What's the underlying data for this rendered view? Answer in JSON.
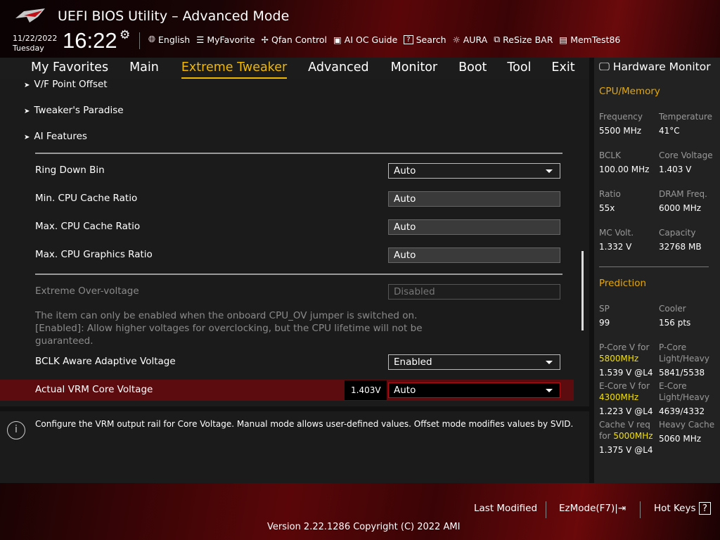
{
  "header": {
    "title": "UEFI BIOS Utility – Advanced Mode",
    "date": "11/22/2022",
    "day": "Tuesday",
    "time": "16:22",
    "tools": [
      {
        "icon": "globe-icon",
        "label": "English"
      },
      {
        "icon": "list-icon",
        "label": "MyFavorite"
      },
      {
        "icon": "fan-icon",
        "label": "Qfan Control"
      },
      {
        "icon": "ai-chip-icon",
        "label": "AI OC Guide"
      },
      {
        "icon": "search-icon",
        "label": "Search"
      },
      {
        "icon": "aura-icon",
        "label": "AURA"
      },
      {
        "icon": "resize-bar-icon",
        "label": "ReSize BAR"
      },
      {
        "icon": "memory-icon",
        "label": "MemTest86"
      }
    ]
  },
  "nav": [
    "My Favorites",
    "Main",
    "Extreme Tweaker",
    "Advanced",
    "Monitor",
    "Boot",
    "Tool",
    "Exit"
  ],
  "main": {
    "submenus": [
      "V/F Point Offset",
      "Tweaker's Paradise",
      "AI Features"
    ],
    "settings": [
      {
        "label": "Ring Down Bin",
        "value": "Auto"
      },
      {
        "label": "Min. CPU Cache Ratio",
        "value": "Auto"
      },
      {
        "label": "Max. CPU Cache Ratio",
        "value": "Auto"
      },
      {
        "label": "Max. CPU Graphics Ratio",
        "value": "Auto"
      }
    ],
    "ov": {
      "label": "Extreme Over-voltage",
      "value": "Disabled",
      "desc1": "The item can only be enabled when the onboard CPU_OV jumper is switched on.",
      "desc2": "[Enabled]: Allow higher voltages for overclocking, but the CPU lifetime will not be",
      "desc3": "guaranteed."
    },
    "bclk": {
      "label": "BCLK Aware Adaptive Voltage",
      "value": "Enabled"
    },
    "vrm": {
      "label": "Actual VRM Core Voltage",
      "reading": "1.403V",
      "value": "Auto"
    }
  },
  "help": "Configure the VRM output rail for Core Voltage. Manual mode allows user-defined values. Offset mode modifies values by SVID.",
  "hw": {
    "title": "Hardware Monitor",
    "cpu_title": "CPU/Memory",
    "cpu": [
      [
        "Frequency",
        "5500 MHz",
        "Temperature",
        "41°C"
      ],
      [
        "BCLK",
        "100.00 MHz",
        "Core Voltage",
        "1.403 V"
      ],
      [
        "Ratio",
        "55x",
        "DRAM Freq.",
        "6000 MHz"
      ],
      [
        "MC Volt.",
        "1.332 V",
        "Capacity",
        "32768 MB"
      ]
    ],
    "pred_title": "Prediction",
    "sp_l": "SP",
    "sp": "99",
    "cooler_l": "Cooler",
    "cooler": "156 pts",
    "p_l": "P-Core V for",
    "p_f": "5800MHz",
    "p_v": "1.539 V @L4",
    "pl_l1": "P-Core",
    "pl_l2": "Light/Heavy",
    "pl_v": "5841/5538",
    "e_l": "E-Core V for",
    "e_f": "4300MHz",
    "e_v": "1.223 V @L4",
    "el_l1": "E-Core",
    "el_l2": "Light/Heavy",
    "el_v": "4639/4332",
    "c_l1": "Cache V req",
    "c_l2": "for",
    "c_f": "5000MHz",
    "c_v": "1.375 V @L4",
    "hc_l": "Heavy Cache",
    "hc_v": "5060 MHz"
  },
  "footer": {
    "last": "Last Modified",
    "ez": "EzMode(F7)",
    "hot": "Hot Keys",
    "hot_key": "?",
    "version": "Version 2.22.1286 Copyright (C) 2022 AMI"
  }
}
